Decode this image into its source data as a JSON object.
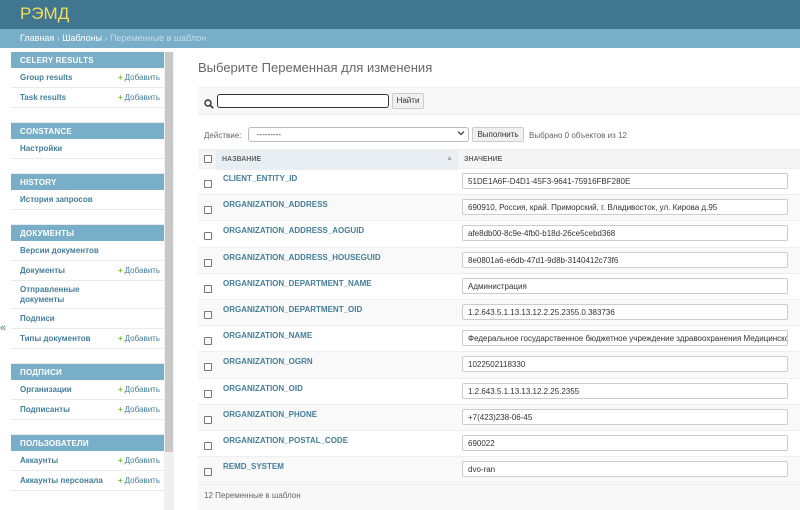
{
  "header": {
    "site_name": "РЭМД"
  },
  "breadcrumbs": {
    "home": "Главная",
    "sep1": " › ",
    "section": "Шаблоны",
    "sep2": " › ",
    "current": "Переменные в шаблон"
  },
  "sidebar": {
    "add_label": "Добавить",
    "modules": [
      {
        "caption": "CELERY RESULTS",
        "items": [
          {
            "label": "Group results",
            "add": true
          },
          {
            "label": "Task results",
            "add": true
          }
        ]
      },
      {
        "caption": "CONSTANCE",
        "items": [
          {
            "label": "Настройки",
            "add": false
          }
        ]
      },
      {
        "caption": "HISTORY",
        "items": [
          {
            "label": "История запросов",
            "add": false
          }
        ]
      },
      {
        "caption": "ДОКУМЕНТЫ",
        "items": [
          {
            "label": "Версии документов",
            "add": false
          },
          {
            "label": "Документы",
            "add": true
          },
          {
            "label": "Отправленные документы",
            "add": false
          },
          {
            "label": "Подписи",
            "add": false
          },
          {
            "label": "Типы документов",
            "add": true
          }
        ]
      },
      {
        "caption": "ПОДПИСИ",
        "items": [
          {
            "label": "Организации",
            "add": true
          },
          {
            "label": "Подписанты",
            "add": true
          }
        ]
      },
      {
        "caption": "ПОЛЬЗОВАТЕЛИ",
        "items": [
          {
            "label": "Аккаунты",
            "add": true
          },
          {
            "label": "Аккаунты персонала",
            "add": true
          }
        ]
      }
    ],
    "collapse_glyph": "«"
  },
  "main": {
    "title": "Выберите Переменная для изменения",
    "search": {
      "value": "",
      "button": "Найти"
    },
    "actions": {
      "label": "Действие:",
      "selected": "---------",
      "go_button": "Выполнить",
      "counter": "Выбрано 0 объектов из 12"
    },
    "table": {
      "columns": [
        "Название",
        "Значение"
      ],
      "rows": [
        {
          "name": "CLIENT_ENTITY_ID",
          "value": "51DE1A6F-D4D1-45F3-9641-75916FBF280E"
        },
        {
          "name": "ORGANIZATION_ADDRESS",
          "value": "690910, Россия, край. Приморский, г. Владивосток, ул. Кирова д.95"
        },
        {
          "name": "ORGANIZATION_ADDRESS_AOGUID",
          "value": "afe8db00-8c9e-4fb0-b18d-26ce5cebd368"
        },
        {
          "name": "ORGANIZATION_ADDRESS_HOUSEGUID",
          "value": "8e0801a6-e6db-47d1-9d8b-3140412c73f6"
        },
        {
          "name": "ORGANIZATION_DEPARTMENT_NAME",
          "value": "Администрация"
        },
        {
          "name": "ORGANIZATION_DEPARTMENT_OID",
          "value": "1.2.643.5.1.13.13.12.2.25.2355.0.383736"
        },
        {
          "name": "ORGANIZATION_NAME",
          "value": "Федеральное государственное бюджетное учреждение здравоохранения Медицинско"
        },
        {
          "name": "ORGANIZATION_OGRN",
          "value": "1022502118330"
        },
        {
          "name": "ORGANIZATION_OID",
          "value": "1.2.643.5.1.13.13.12.2.25.2355"
        },
        {
          "name": "ORGANIZATION_PHONE",
          "value": "+7(423)238-06-45"
        },
        {
          "name": "ORGANIZATION_POSTAL_CODE",
          "value": "690022"
        },
        {
          "name": "REMD_SYSTEM",
          "value": "dvo-ran"
        }
      ]
    },
    "paginator": "12 Переменные в шаблон"
  },
  "colors": {
    "header": "#417690",
    "breadcrumbs": "#79aec8",
    "site_name": "#f5dd5d",
    "link": "#447e9b",
    "add": "#70bf2b"
  },
  "icons": {
    "search": "search-icon",
    "add": "plus-icon",
    "sort": "sort-asc-icon",
    "select": "chevron-down-icon"
  }
}
